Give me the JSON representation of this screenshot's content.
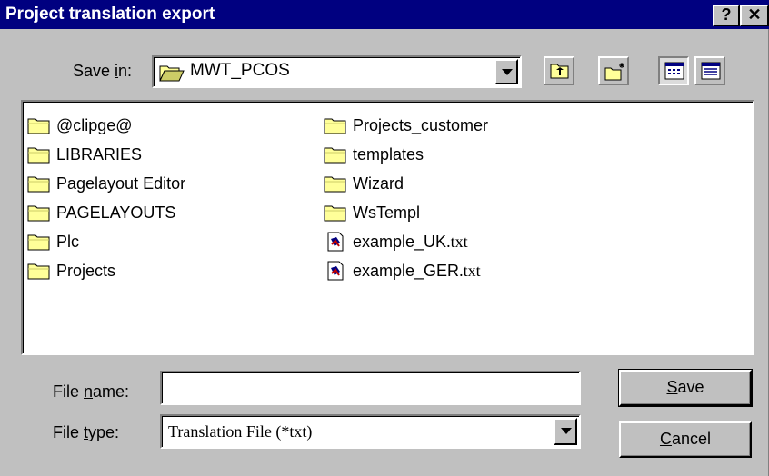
{
  "window": {
    "title": "Project translation export",
    "help_button": "?",
    "close_button": "✕"
  },
  "save_in": {
    "label_pre": "Save ",
    "label_accel": "i",
    "label_post": "n:",
    "value": "MWT_PCOS"
  },
  "toolbar": {
    "up_folder": "up-one-level",
    "new_folder": "create-new-folder",
    "list_view": "list-view",
    "details_view": "details-view"
  },
  "files": {
    "column1": [
      {
        "name": "@clipge@",
        "type": "folder"
      },
      {
        "name": "LIBRARIES",
        "type": "folder"
      },
      {
        "name": "Pagelayout Editor",
        "type": "folder"
      },
      {
        "name": "PAGELAYOUTS",
        "type": "folder"
      },
      {
        "name": "Plc",
        "type": "folder"
      },
      {
        "name": "Projects",
        "type": "folder"
      }
    ],
    "column2": [
      {
        "name": "Projects_customer",
        "type": "folder"
      },
      {
        "name": "templates",
        "type": "folder"
      },
      {
        "name": "Wizard",
        "type": "folder"
      },
      {
        "name": "WsTempl",
        "type": "folder"
      },
      {
        "name_main": "example_UK",
        "name_ext": ".txt",
        "type": "file"
      },
      {
        "name_main": "example_GER",
        "name_ext": ".txt",
        "type": "file"
      }
    ]
  },
  "file_name": {
    "label_pre": "File ",
    "label_accel": "n",
    "label_post": "ame:",
    "value": ""
  },
  "file_type": {
    "label_pre": "File ",
    "label_accel": "t",
    "label_post": "ype:",
    "value": "Translation File (*txt)"
  },
  "buttons": {
    "save_accel": "S",
    "save_rest": "ave",
    "cancel_accel": "C",
    "cancel_rest": "ancel"
  },
  "colors": {
    "titlebar": "#000080",
    "face": "#c0c0c0",
    "folder": "#ffff99"
  }
}
